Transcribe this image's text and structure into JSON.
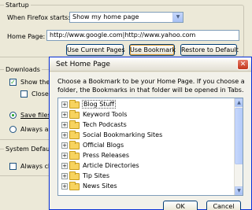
{
  "startup": {
    "group_title": "Startup",
    "when_label": "When Firefox starts:",
    "when_value": "Show my home page",
    "home_label": "Home Page:",
    "home_value": "http://www.google.com|http://www.yahoo.com",
    "use_current_label": "Use Current Pages",
    "use_bookmark_label": "Use Bookmark",
    "restore_label": "Restore to Default"
  },
  "downloads": {
    "group_title": "Downloads",
    "show_label": "Show the Do",
    "close_label": "Close it",
    "save_label": "Save files to",
    "ask_label": "Always ask m"
  },
  "system_defaults": {
    "group_title": "System Defaults",
    "always_label": "Always chec"
  },
  "dialog": {
    "title": "Set Home Page",
    "close_glyph": "✕",
    "message": "Choose a Bookmark to be your Home Page. If you choose a folder, the Bookmarks in that folder will be opened in Tabs.",
    "folders": [
      "Blog Stuff",
      "Keyword Tools",
      "Tech Podcasts",
      "Social Bookmarking Sites",
      "Official Blogs",
      "Press Releases",
      "Article Directories",
      "Tip Sites",
      "News Sites"
    ],
    "expander_glyph": "+",
    "ok_label": "OK",
    "cancel_label": "Cancel"
  },
  "icons": {
    "dropdown_arrow": "▼",
    "scroll_up": "▲",
    "scroll_down": "▼",
    "check": "✓"
  },
  "colors": {
    "dialog_border": "#0831d9",
    "close_button": "#c2351a",
    "folder": "#f7d35f"
  }
}
